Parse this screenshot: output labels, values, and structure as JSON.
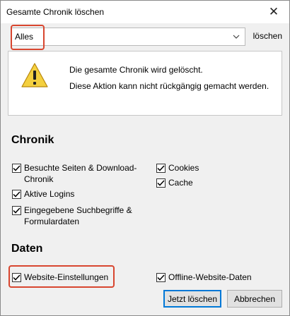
{
  "window": {
    "title": "Gesamte Chronik löschen",
    "close_glyph": "✕"
  },
  "time_range": {
    "selected": "Alles",
    "label": "löschen"
  },
  "warning": {
    "icon": "warning-triangle-icon",
    "line1": "Die gesamte Chronik wird gelöscht.",
    "line2": "Diese Aktion kann nicht rückgängig gemacht werden."
  },
  "chronik": {
    "title": "Chronik",
    "items": [
      {
        "label": "Besuchte Seiten & Download-Chronik",
        "checked": true
      },
      {
        "label": "Aktive Logins",
        "checked": true
      },
      {
        "label": "Eingegebene Suchbegriffe & Formulardaten",
        "checked": true
      },
      {
        "label": "Cookies",
        "checked": true
      },
      {
        "label": "Cache",
        "checked": true
      }
    ]
  },
  "daten": {
    "title": "Daten",
    "items": [
      {
        "label": "Website-Einstellungen",
        "checked": true
      },
      {
        "label": "Offline-Website-Daten",
        "checked": true
      }
    ]
  },
  "buttons": {
    "confirm": "Jetzt löschen",
    "cancel": "Abbrechen"
  },
  "colors": {
    "annotation_highlight": "#d8462f",
    "default_button_border": "#0078d7"
  }
}
